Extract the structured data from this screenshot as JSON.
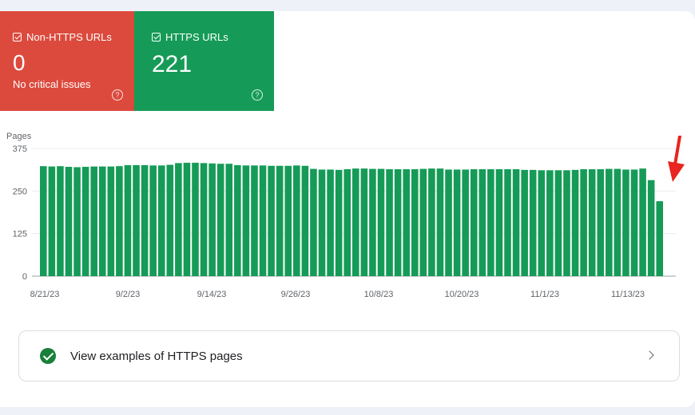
{
  "tiles": {
    "non_https": {
      "label": "Non-HTTPS URLs",
      "value": "0",
      "subtext": "No critical issues",
      "color": "#dc4a3d",
      "help_icon": "question-circle-icon"
    },
    "https": {
      "label": "HTTPS URLs",
      "value": "221",
      "color": "#159b57",
      "help_icon": "question-circle-icon"
    }
  },
  "chart_data": {
    "type": "bar",
    "ylabel": "Pages",
    "ylim": [
      0,
      375
    ],
    "yticks": [
      "0",
      "125",
      "250",
      "375"
    ],
    "xtick_labels": [
      "8/21/23",
      "9/2/23",
      "9/14/23",
      "9/26/23",
      "10/8/23",
      "10/20/23",
      "11/1/23",
      "11/13/23"
    ],
    "bar_color": "#159b57",
    "values": [
      323,
      322,
      323,
      321,
      320,
      321,
      322,
      322,
      322,
      323,
      326,
      326,
      326,
      325,
      325,
      327,
      332,
      333,
      333,
      332,
      331,
      330,
      330,
      326,
      325,
      325,
      325,
      324,
      324,
      324,
      325,
      324,
      315,
      313,
      313,
      312,
      314,
      316,
      316,
      315,
      315,
      314,
      314,
      314,
      314,
      315,
      316,
      316,
      313,
      313,
      313,
      314,
      314,
      314,
      314,
      314,
      314,
      312,
      312,
      311,
      311,
      311,
      311,
      312,
      314,
      314,
      314,
      315,
      315,
      313,
      313,
      316,
      282,
      220
    ],
    "annotation": {
      "type": "arrow",
      "color": "#e8251e"
    }
  },
  "examples_link": {
    "label": "View examples of HTTPS pages",
    "icon": "check-circle-icon",
    "chevron": "chevron-right-icon"
  }
}
